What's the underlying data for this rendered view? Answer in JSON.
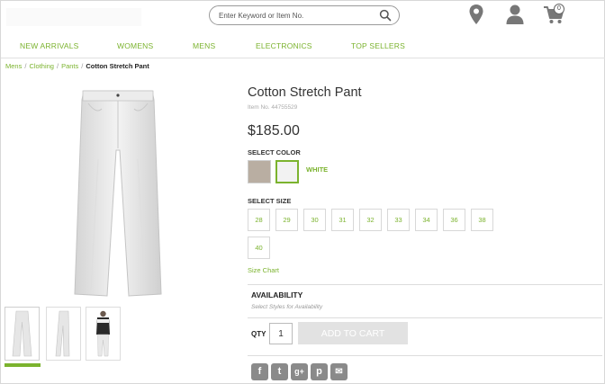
{
  "header": {
    "search_placeholder": "Enter Keyword or Item No.",
    "cart_count": "0"
  },
  "nav": {
    "items": [
      "NEW ARRIVALS",
      "WOMENS",
      "MENS",
      "ELECTRONICS",
      "TOP SELLERS"
    ]
  },
  "breadcrumb": {
    "items": [
      "Mens",
      "Clothing",
      "Pants"
    ],
    "current": "Cotton Stretch Pant"
  },
  "product": {
    "title": "Cotton Stretch Pant",
    "item_no": "Item No. 44755529",
    "price": "$185.00",
    "select_color_label": "SELECT COLOR",
    "selected_color": "WHITE",
    "colors": {
      "tan": "#b9aea2",
      "white": "#f2f2f2",
      "accent": "#7bb32e"
    },
    "select_size_label": "SELECT SIZE",
    "sizes": [
      "28",
      "29",
      "30",
      "31",
      "32",
      "33",
      "34",
      "36",
      "38",
      "40"
    ],
    "size_chart_label": "Size Chart",
    "availability_title": "AVAILABILITY",
    "availability_note": "Select Styles for Availability",
    "qty_label": "QTY",
    "qty_value": "1",
    "add_to_cart_label": "ADD TO CART"
  },
  "social": {
    "icons": [
      "facebook-icon",
      "twitter-icon",
      "google-plus-icon",
      "pinterest-icon",
      "email-icon"
    ],
    "glyphs": [
      "f",
      "t",
      "g+",
      "p",
      "✉"
    ]
  }
}
